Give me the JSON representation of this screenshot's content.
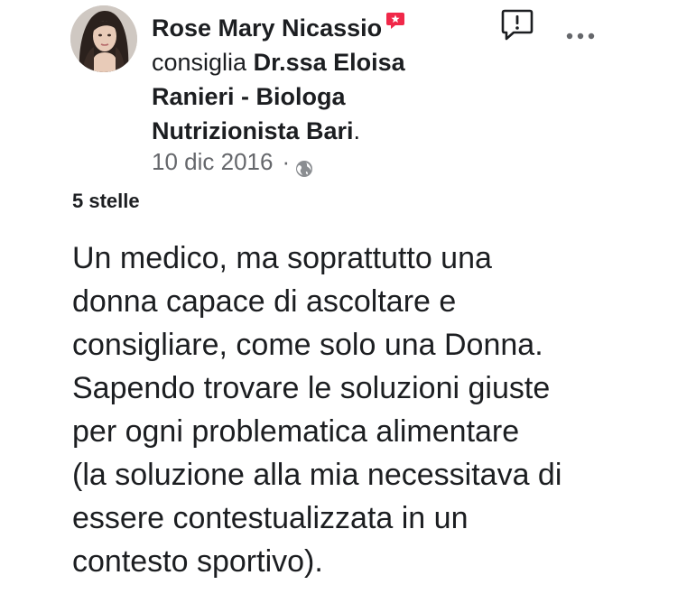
{
  "post": {
    "author": "Rose Mary Nicassio",
    "verb": "consiglia",
    "target": "Dr.ssa Eloisa Ranieri - Biologa Nutrizionista Bari",
    "target_end": ".",
    "date": "10 dic 2016",
    "separator": "·",
    "privacy_icon": "globe-icon",
    "badge_icon": "recommend-badge-icon",
    "badge_color": "#f02849",
    "rating": "5 stelle",
    "review_lines": [
      "Un medico, ma soprattutto una",
      "donna capace di ascoltare e",
      "consigliare, come solo una Donna.",
      "Sapendo trovare le soluzioni giuste",
      "per ogni problematica alimentare",
      "(la soluzione alla mia necessitava di",
      "essere contestualizzata in un",
      "contesto sportivo)."
    ]
  },
  "actions": {
    "report_icon": "report-icon",
    "more_icon": "more-options-icon"
  }
}
